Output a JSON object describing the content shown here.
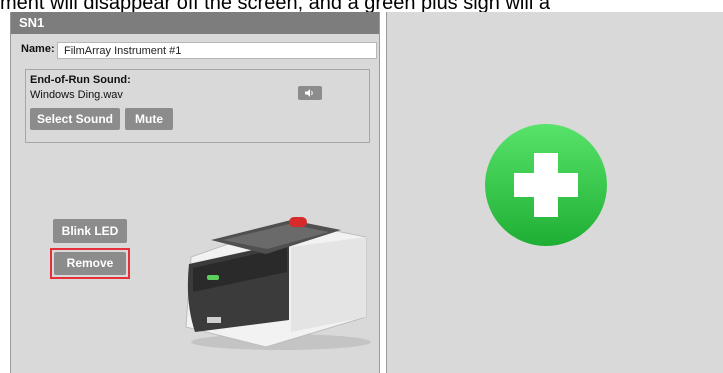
{
  "caption": "ment will disappear off the screen, and a green plus sign will a",
  "panel": {
    "title": "SN1",
    "name_label": "Name:",
    "name_value": "FilmArray Instrument #1",
    "sound_title": "End-of-Run Sound:",
    "sound_file": "Windows Ding.wav",
    "speaker_icon": "speaker-icon",
    "select_sound_label": "Select Sound",
    "mute_label": "Mute",
    "blink_label": "Blink LED",
    "remove_label": "Remove"
  },
  "colors": {
    "remove_highlight": "#e5303a",
    "plus_green": "#2fc244"
  }
}
